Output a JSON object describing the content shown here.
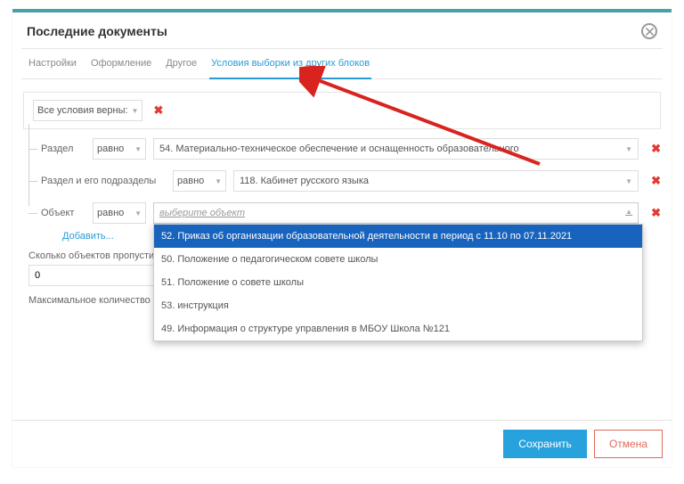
{
  "title": "Последние документы",
  "tabs": [
    "Настройки",
    "Оформление",
    "Другое",
    "Условия выборки из других блоков"
  ],
  "activeTab": 3,
  "root": {
    "label": "Все условия верны:"
  },
  "row1": {
    "label": "Раздел",
    "op": "равно",
    "value": "54. Материально-техническое обеспечение и оснащенность образовательного"
  },
  "row2": {
    "label": "Раздел и его подразделы",
    "op": "равно",
    "value": "118. Кабинет русского языка"
  },
  "row3": {
    "label": "Объект",
    "op": "равно",
    "placeholder": "выберите объект"
  },
  "dropdown": {
    "items": [
      "52. Приказ об организации образовательной деятельности в период с 11.10 по 07.11.2021",
      "50. Положение о педагогическом совете школы",
      "51. Положение о совете школы",
      "53. инструкция",
      "49. Информация о структуре управления в МБОУ Школа №121"
    ],
    "activeIndex": 0
  },
  "addLink": "Добавить...",
  "skipLabel": "Сколько объектов пропустить от начала вы",
  "skipValue": "0",
  "maxLabel": "Максимальное количество записей в выбор",
  "saveLabel": "Сохранить",
  "cancelLabel": "Отмена"
}
